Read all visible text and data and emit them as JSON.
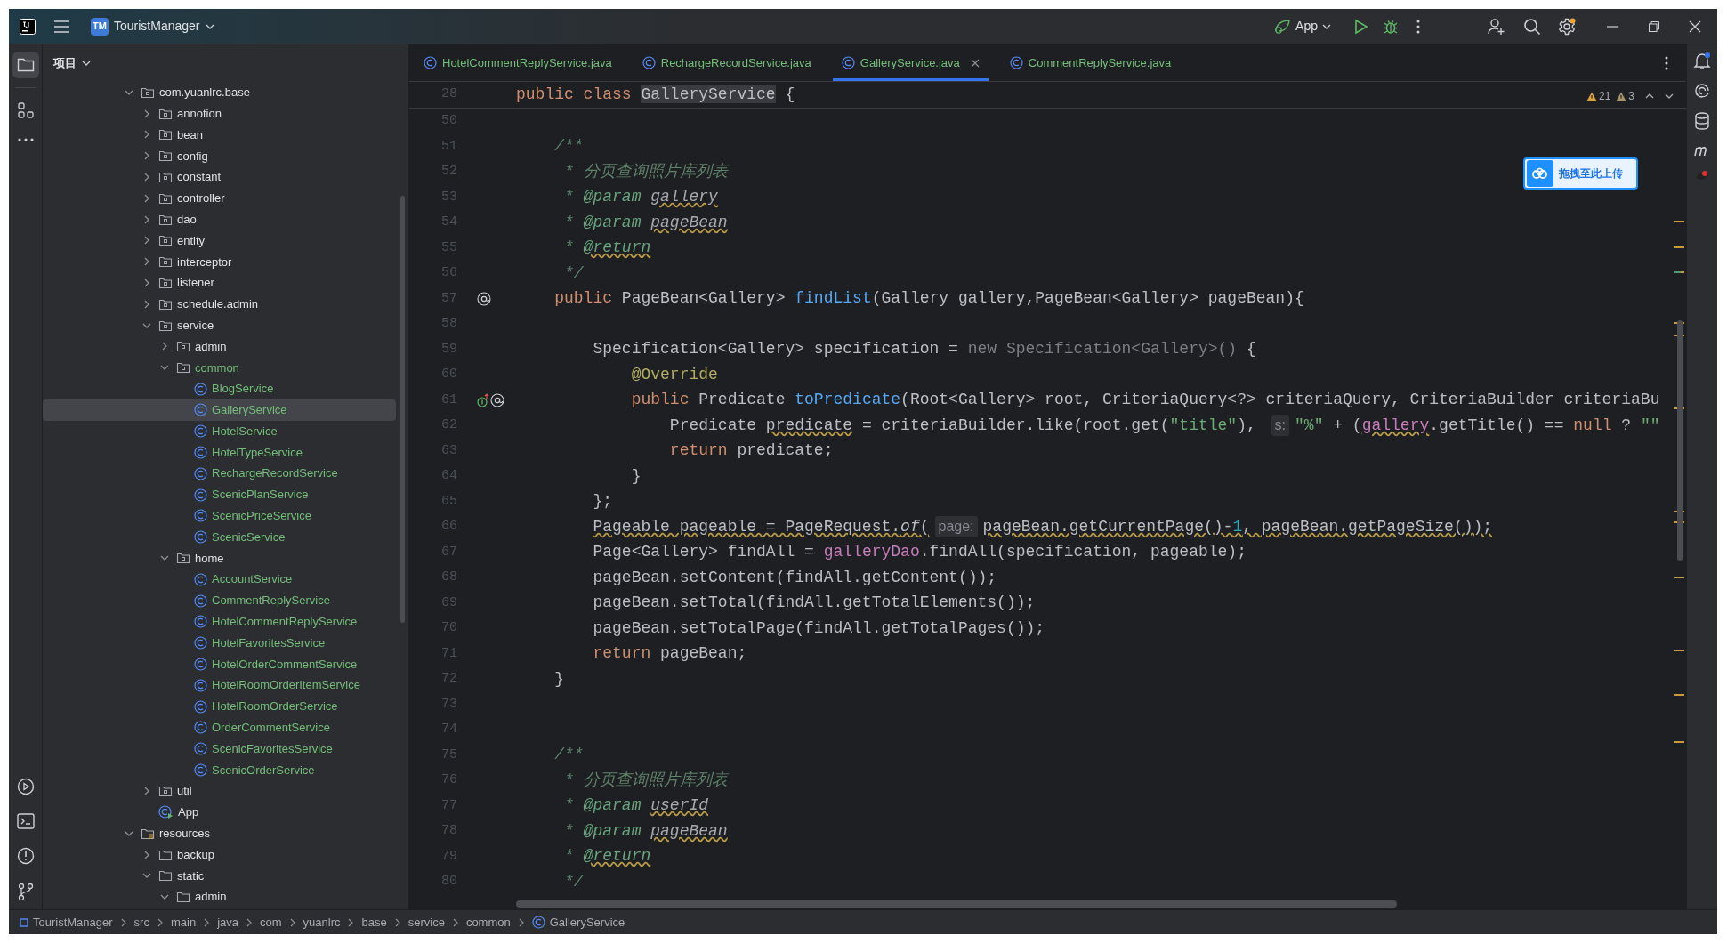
{
  "title_bar": {
    "project_badge": "TM",
    "project_name": "TouristManager",
    "run_config": "App"
  },
  "project_panel": {
    "title": "项目",
    "tree": [
      {
        "label": "com.yuanlrc.base",
        "kind": "package",
        "expanded": true,
        "added": false,
        "selected": false,
        "children": [
          {
            "label": "annotion",
            "kind": "package",
            "expanded": false,
            "added": false,
            "selected": false
          },
          {
            "label": "bean",
            "kind": "package",
            "expanded": false,
            "added": false,
            "selected": false
          },
          {
            "label": "config",
            "kind": "package",
            "expanded": false,
            "added": false,
            "selected": false
          },
          {
            "label": "constant",
            "kind": "package",
            "expanded": false,
            "added": false,
            "selected": false
          },
          {
            "label": "controller",
            "kind": "package",
            "expanded": false,
            "added": false,
            "selected": false
          },
          {
            "label": "dao",
            "kind": "package",
            "expanded": false,
            "added": false,
            "selected": false
          },
          {
            "label": "entity",
            "kind": "package",
            "expanded": false,
            "added": false,
            "selected": false
          },
          {
            "label": "interceptor",
            "kind": "package",
            "expanded": false,
            "added": false,
            "selected": false
          },
          {
            "label": "listener",
            "kind": "package",
            "expanded": false,
            "added": false,
            "selected": false
          },
          {
            "label": "schedule.admin",
            "kind": "package",
            "expanded": false,
            "added": false,
            "selected": false
          },
          {
            "label": "service",
            "kind": "package",
            "expanded": true,
            "added": false,
            "selected": false,
            "children": [
              {
                "label": "admin",
                "kind": "package",
                "expanded": false,
                "added": false,
                "selected": false
              },
              {
                "label": "common",
                "kind": "package",
                "expanded": true,
                "added": true,
                "selected": false,
                "children": [
                  {
                    "label": "BlogService",
                    "kind": "class",
                    "added": true,
                    "selected": false
                  },
                  {
                    "label": "GalleryService",
                    "kind": "class",
                    "added": true,
                    "selected": true
                  },
                  {
                    "label": "HotelService",
                    "kind": "class",
                    "added": true,
                    "selected": false
                  },
                  {
                    "label": "HotelTypeService",
                    "kind": "class",
                    "added": true,
                    "selected": false
                  },
                  {
                    "label": "RechargeRecordService",
                    "kind": "class",
                    "added": true,
                    "selected": false
                  },
                  {
                    "label": "ScenicPlanService",
                    "kind": "class",
                    "added": true,
                    "selected": false
                  },
                  {
                    "label": "ScenicPriceService",
                    "kind": "class",
                    "added": true,
                    "selected": false
                  },
                  {
                    "label": "ScenicService",
                    "kind": "class",
                    "added": true,
                    "selected": false
                  }
                ]
              },
              {
                "label": "home",
                "kind": "package",
                "expanded": true,
                "added": false,
                "selected": false,
                "children": [
                  {
                    "label": "AccountService",
                    "kind": "class",
                    "added": true,
                    "selected": false
                  },
                  {
                    "label": "CommentReplyService",
                    "kind": "class",
                    "added": true,
                    "selected": false
                  },
                  {
                    "label": "HotelCommentReplyService",
                    "kind": "class",
                    "added": true,
                    "selected": false
                  },
                  {
                    "label": "HotelFavoritesService",
                    "kind": "class",
                    "added": true,
                    "selected": false
                  },
                  {
                    "label": "HotelOrderCommentService",
                    "kind": "class",
                    "added": true,
                    "selected": false
                  },
                  {
                    "label": "HotelRoomOrderItemService",
                    "kind": "class",
                    "added": true,
                    "selected": false
                  },
                  {
                    "label": "HotelRoomOrderService",
                    "kind": "class",
                    "added": true,
                    "selected": false
                  },
                  {
                    "label": "OrderCommentService",
                    "kind": "class",
                    "added": true,
                    "selected": false
                  },
                  {
                    "label": "ScenicFavoritesService",
                    "kind": "class",
                    "added": true,
                    "selected": false
                  },
                  {
                    "label": "ScenicOrderService",
                    "kind": "class",
                    "added": true,
                    "selected": false
                  }
                ]
              }
            ]
          },
          {
            "label": "util",
            "kind": "package",
            "expanded": false,
            "added": false,
            "selected": false
          },
          {
            "label": "App",
            "kind": "app",
            "added": false,
            "selected": false
          }
        ]
      },
      {
        "label": "resources",
        "kind": "resources",
        "expanded": true,
        "added": false,
        "selected": false,
        "children": [
          {
            "label": "backup",
            "kind": "folder",
            "expanded": false,
            "added": false,
            "selected": false
          },
          {
            "label": "static",
            "kind": "folder",
            "expanded": true,
            "added": false,
            "selected": false,
            "children": [
              {
                "label": "admin",
                "kind": "folder",
                "expanded": true,
                "added": false,
                "selected": false
              }
            ]
          }
        ]
      }
    ]
  },
  "tabs": [
    {
      "label": "HotelCommentReplyService.java",
      "selected": false
    },
    {
      "label": "RechargeRecordService.java",
      "selected": false
    },
    {
      "label": "GalleryService.java",
      "selected": true
    },
    {
      "label": "CommentReplyService.java",
      "selected": false
    }
  ],
  "inspections": {
    "warnings": "21",
    "weak_warnings": "3"
  },
  "upload_button": "拖拽至此上传",
  "editor": {
    "sticky_line": {
      "number": "28",
      "tokens": [
        {
          "text": "public class ",
          "kind": "keyword"
        },
        {
          "text": "GalleryService",
          "kind": "highlight"
        },
        {
          "text": " {",
          "kind": "plain"
        }
      ]
    },
    "lines": [
      {
        "number": "50"
      },
      {
        "number": "51",
        "tokens": [
          {
            "text": "    /**",
            "kind": "doc"
          }
        ]
      },
      {
        "number": "52",
        "tokens": [
          {
            "text": "     * 分页查询照片库列表",
            "kind": "doc"
          }
        ]
      },
      {
        "number": "53",
        "tokens": [
          {
            "text": "     * ",
            "kind": "doc"
          },
          {
            "text": "@param ",
            "kind": "doctag"
          },
          {
            "text": "gallery",
            "kind": "docparam"
          }
        ]
      },
      {
        "number": "54",
        "tokens": [
          {
            "text": "     * ",
            "kind": "doc"
          },
          {
            "text": "@param ",
            "kind": "doctag"
          },
          {
            "text": "pageBean",
            "kind": "docparam"
          }
        ]
      },
      {
        "number": "55",
        "tokens": [
          {
            "text": "     * ",
            "kind": "doc"
          },
          {
            "text": "@return",
            "kind": "doctagwarn"
          }
        ]
      },
      {
        "number": "56",
        "tokens": [
          {
            "text": "     */",
            "kind": "doc"
          }
        ]
      },
      {
        "number": "57",
        "gutter": [
          {
            "kind": "at"
          }
        ],
        "tokens": [
          {
            "text": "    public",
            "kind": "keyword"
          },
          {
            "text": " PageBean<Gallery> ",
            "kind": "plain"
          },
          {
            "text": "findList",
            "kind": "decl"
          },
          {
            "text": "(Gallery gallery,PageBean<Gallery> pageBean){",
            "kind": "plain"
          }
        ]
      },
      {
        "number": "58"
      },
      {
        "number": "59",
        "tokens": [
          {
            "text": "        Specification<Gallery> specification = ",
            "kind": "plain"
          },
          {
            "text": "new Specification<Gallery>()",
            "kind": "muted"
          },
          {
            "text": " {",
            "kind": "plain"
          }
        ]
      },
      {
        "number": "60",
        "tokens": [
          {
            "text": "            @Override",
            "kind": "annotation"
          }
        ]
      },
      {
        "number": "61",
        "gutter": [
          {
            "kind": "override"
          },
          {
            "kind": "at"
          }
        ],
        "tokens": [
          {
            "text": "            public",
            "kind": "keyword"
          },
          {
            "text": " Predicate ",
            "kind": "plain"
          },
          {
            "text": "toPredicate",
            "kind": "decl"
          },
          {
            "text": "(Root<Gallery> root, CriteriaQuery<?> criteriaQuery, CriteriaBuilder criteriaBu",
            "kind": "plain"
          }
        ]
      },
      {
        "number": "62",
        "tokens": [
          {
            "text": "                Predicate ",
            "kind": "plain"
          },
          {
            "text": "predicate",
            "kind": "warn"
          },
          {
            "text": " = criteriaBuilder.like(root.get(",
            "kind": "plain"
          },
          {
            "text": "\"title\"",
            "kind": "string"
          },
          {
            "text": "), ",
            "kind": "plain"
          },
          {
            "text": "s:",
            "kind": "hint"
          },
          {
            "text": "\"%\"",
            "kind": "string"
          },
          {
            "text": " + (",
            "kind": "plain"
          },
          {
            "text": "gallery",
            "kind": "fieldwarn"
          },
          {
            "text": ".getTitle() == ",
            "kind": "plain"
          },
          {
            "text": "null",
            "kind": "keyword"
          },
          {
            "text": " ? ",
            "kind": "plain"
          },
          {
            "text": "\"\"",
            "kind": "string"
          }
        ]
      },
      {
        "number": "63",
        "tokens": [
          {
            "text": "                return",
            "kind": "keyword"
          },
          {
            "text": " predicate;",
            "kind": "plain"
          }
        ]
      },
      {
        "number": "64",
        "tokens": [
          {
            "text": "            }",
            "kind": "plain"
          }
        ]
      },
      {
        "number": "65",
        "tokens": [
          {
            "text": "        };",
            "kind": "plain"
          }
        ]
      },
      {
        "number": "66",
        "tokens": [
          {
            "text": "        Pageable pageable = PageRequest.",
            "kind": "warn"
          },
          {
            "text": "of",
            "kind": "warnitalic"
          },
          {
            "text": "(",
            "kind": "warn"
          },
          {
            "text": "page:",
            "kind": "hint"
          },
          {
            "text": "pageBean.getCurrentPage()-",
            "kind": "warn"
          },
          {
            "text": "1",
            "kind": "warnnumber"
          },
          {
            "text": ", pageBean.getPageSize());",
            "kind": "warn"
          }
        ]
      },
      {
        "number": "67",
        "tokens": [
          {
            "text": "        Page<Gallery> findAll = ",
            "kind": "plain"
          },
          {
            "text": "galleryDao",
            "kind": "field"
          },
          {
            "text": ".findAll(specification, pageable);",
            "kind": "plain"
          }
        ]
      },
      {
        "number": "68",
        "tokens": [
          {
            "text": "        pageBean.setContent(findAll.getContent());",
            "kind": "plain"
          }
        ]
      },
      {
        "number": "69",
        "tokens": [
          {
            "text": "        pageBean.setTotal(findAll.getTotalElements());",
            "kind": "plain"
          }
        ]
      },
      {
        "number": "70",
        "tokens": [
          {
            "text": "        pageBean.setTotalPage(findAll.getTotalPages());",
            "kind": "plain"
          }
        ]
      },
      {
        "number": "71",
        "tokens": [
          {
            "text": "        return",
            "kind": "keyword"
          },
          {
            "text": " pageBean;",
            "kind": "plain"
          }
        ]
      },
      {
        "number": "72",
        "tokens": [
          {
            "text": "    }",
            "kind": "plain"
          }
        ]
      },
      {
        "number": "73"
      },
      {
        "number": "74"
      },
      {
        "number": "75",
        "tokens": [
          {
            "text": "    /**",
            "kind": "doc"
          }
        ]
      },
      {
        "number": "76",
        "tokens": [
          {
            "text": "     * 分页查询照片库列表",
            "kind": "doc"
          }
        ]
      },
      {
        "number": "77",
        "tokens": [
          {
            "text": "     * ",
            "kind": "doc"
          },
          {
            "text": "@param ",
            "kind": "doctag"
          },
          {
            "text": "userId",
            "kind": "docparam"
          }
        ]
      },
      {
        "number": "78",
        "tokens": [
          {
            "text": "     * ",
            "kind": "doc"
          },
          {
            "text": "@param ",
            "kind": "doctag"
          },
          {
            "text": "pageBean",
            "kind": "docparam"
          }
        ]
      },
      {
        "number": "79",
        "tokens": [
          {
            "text": "     * ",
            "kind": "doc"
          },
          {
            "text": "@return",
            "kind": "doctagwarn"
          }
        ]
      },
      {
        "number": "80",
        "tokens": [
          {
            "text": "     */",
            "kind": "doc"
          }
        ]
      }
    ]
  },
  "breadcrumbs": [
    {
      "label": "TouristManager",
      "kind": "module"
    },
    {
      "label": "src",
      "kind": "dir"
    },
    {
      "label": "main",
      "kind": "dir"
    },
    {
      "label": "java",
      "kind": "dir"
    },
    {
      "label": "com",
      "kind": "dir"
    },
    {
      "label": "yuanlrc",
      "kind": "dir"
    },
    {
      "label": "base",
      "kind": "dir"
    },
    {
      "label": "service",
      "kind": "dir"
    },
    {
      "label": "common",
      "kind": "dir"
    },
    {
      "label": "GalleryService",
      "kind": "class"
    }
  ]
}
